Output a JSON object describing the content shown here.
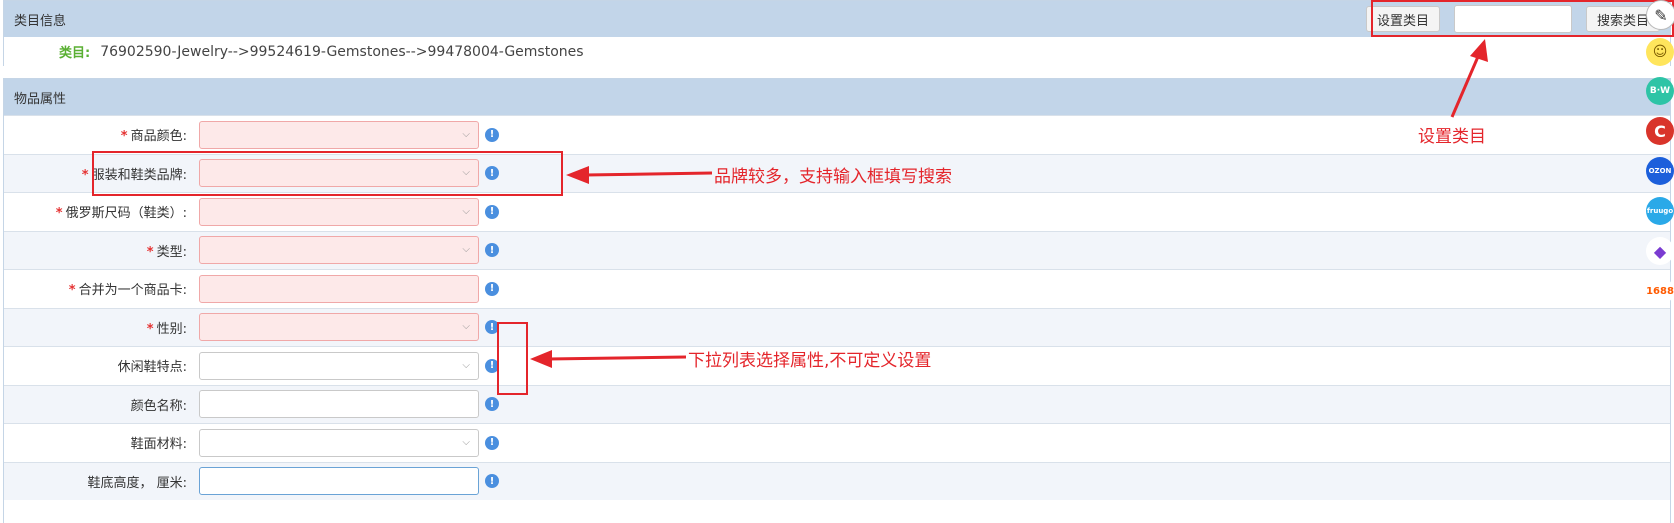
{
  "category_panel": {
    "title": "类目信息",
    "set_category_button": "设置类目",
    "search_category_button": "搜索类目",
    "category_label": "类目:",
    "category_path": "76902590-Jewelry-->99524619-Gemstones-->99478004-Gemstones"
  },
  "attributes_panel": {
    "title": "物品属性",
    "rows": [
      {
        "label": "商品颜色:",
        "required": true,
        "type": "select"
      },
      {
        "label": "服装和鞋类品牌:",
        "required": true,
        "type": "select"
      },
      {
        "label": "俄罗斯尺码（鞋类）:",
        "required": true,
        "type": "select"
      },
      {
        "label": "类型:",
        "required": true,
        "type": "select"
      },
      {
        "label": "合并为一个商品卡:",
        "required": true,
        "type": "input"
      },
      {
        "label": "性别:",
        "required": true,
        "type": "select"
      },
      {
        "label": "休闲鞋特点:",
        "required": false,
        "type": "select"
      },
      {
        "label": "颜色名称:",
        "required": false,
        "type": "input"
      },
      {
        "label": "鞋面材料:",
        "required": false,
        "type": "select"
      },
      {
        "label": "鞋底高度， 厘米:",
        "required": false,
        "type": "input"
      }
    ]
  },
  "annotations": {
    "set_category": "设置类目",
    "brand_search": "品牌较多，支持输入框填写搜索",
    "dropdown": "下拉列表选择属性,不可定义设置"
  },
  "side_icons": [
    "B·W",
    "C",
    "OZON",
    "fruugo",
    "1688"
  ],
  "colors": {
    "header_bg": "#c2d5e9",
    "alt_row_bg": "#f2f5fa",
    "required_star": "#e53333",
    "annotation_red": "#e4252b",
    "info_blue": "#4a8fdf",
    "category_label_green": "#5ab033"
  }
}
